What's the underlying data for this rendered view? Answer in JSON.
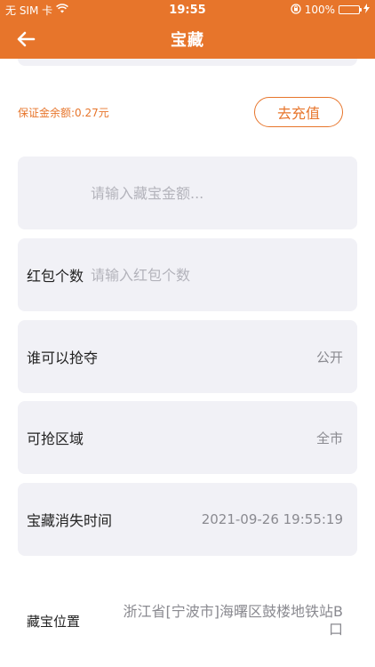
{
  "status_bar": {
    "carrier": "无 SIM 卡",
    "time": "19:55",
    "battery_percent": "100%",
    "battery_level": 1.0,
    "wifi_icon": "wifi-icon",
    "lock_icon": "orientation-lock-icon",
    "charging_icon": "charging-bolt-icon"
  },
  "navbar": {
    "title": "宝藏",
    "back_icon": "arrow-left-icon",
    "accent_color": "#e7752b"
  },
  "deposit": {
    "balance_text": "保证金余额:0.27元",
    "recharge_label": "去充值"
  },
  "form": {
    "amount": {
      "label": "",
      "placeholder": "请输入藏宝金额...",
      "value": ""
    },
    "count": {
      "label": "红包个数",
      "placeholder": "请输入红包个数",
      "value": ""
    },
    "who": {
      "label": "谁可以抢夺",
      "value": "公开"
    },
    "area": {
      "label": "可抢区域",
      "value": "全市"
    },
    "expire": {
      "label": "宝藏消失时间",
      "value": "2021-09-26 19:55:19"
    },
    "location": {
      "label": "藏宝位置",
      "value": "浙江省[宁波市]海曙区鼓楼地铁站B口"
    }
  }
}
